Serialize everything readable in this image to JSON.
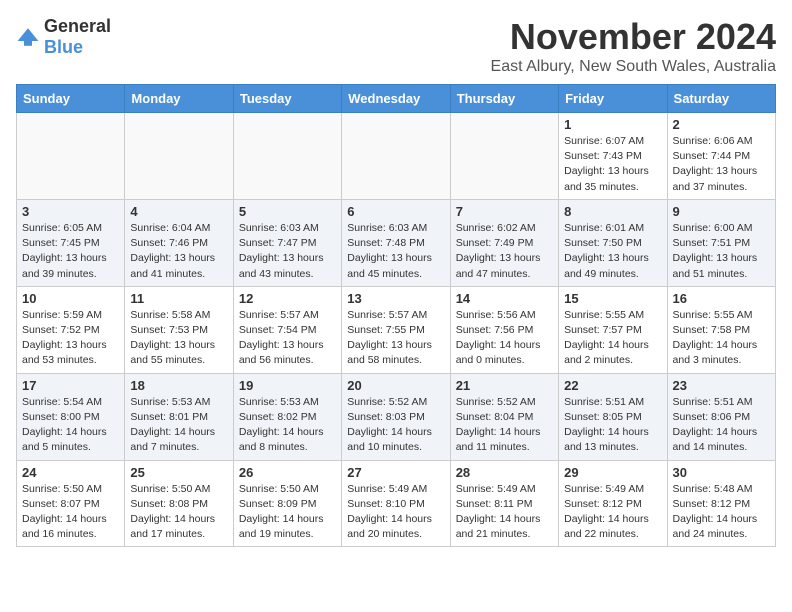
{
  "logo": {
    "general": "General",
    "blue": "Blue"
  },
  "title": "November 2024",
  "location": "East Albury, New South Wales, Australia",
  "headers": [
    "Sunday",
    "Monday",
    "Tuesday",
    "Wednesday",
    "Thursday",
    "Friday",
    "Saturday"
  ],
  "weeks": [
    [
      {
        "day": "",
        "info": ""
      },
      {
        "day": "",
        "info": ""
      },
      {
        "day": "",
        "info": ""
      },
      {
        "day": "",
        "info": ""
      },
      {
        "day": "",
        "info": ""
      },
      {
        "day": "1",
        "info": "Sunrise: 6:07 AM\nSunset: 7:43 PM\nDaylight: 13 hours\nand 35 minutes."
      },
      {
        "day": "2",
        "info": "Sunrise: 6:06 AM\nSunset: 7:44 PM\nDaylight: 13 hours\nand 37 minutes."
      }
    ],
    [
      {
        "day": "3",
        "info": "Sunrise: 6:05 AM\nSunset: 7:45 PM\nDaylight: 13 hours\nand 39 minutes."
      },
      {
        "day": "4",
        "info": "Sunrise: 6:04 AM\nSunset: 7:46 PM\nDaylight: 13 hours\nand 41 minutes."
      },
      {
        "day": "5",
        "info": "Sunrise: 6:03 AM\nSunset: 7:47 PM\nDaylight: 13 hours\nand 43 minutes."
      },
      {
        "day": "6",
        "info": "Sunrise: 6:03 AM\nSunset: 7:48 PM\nDaylight: 13 hours\nand 45 minutes."
      },
      {
        "day": "7",
        "info": "Sunrise: 6:02 AM\nSunset: 7:49 PM\nDaylight: 13 hours\nand 47 minutes."
      },
      {
        "day": "8",
        "info": "Sunrise: 6:01 AM\nSunset: 7:50 PM\nDaylight: 13 hours\nand 49 minutes."
      },
      {
        "day": "9",
        "info": "Sunrise: 6:00 AM\nSunset: 7:51 PM\nDaylight: 13 hours\nand 51 minutes."
      }
    ],
    [
      {
        "day": "10",
        "info": "Sunrise: 5:59 AM\nSunset: 7:52 PM\nDaylight: 13 hours\nand 53 minutes."
      },
      {
        "day": "11",
        "info": "Sunrise: 5:58 AM\nSunset: 7:53 PM\nDaylight: 13 hours\nand 55 minutes."
      },
      {
        "day": "12",
        "info": "Sunrise: 5:57 AM\nSunset: 7:54 PM\nDaylight: 13 hours\nand 56 minutes."
      },
      {
        "day": "13",
        "info": "Sunrise: 5:57 AM\nSunset: 7:55 PM\nDaylight: 13 hours\nand 58 minutes."
      },
      {
        "day": "14",
        "info": "Sunrise: 5:56 AM\nSunset: 7:56 PM\nDaylight: 14 hours\nand 0 minutes."
      },
      {
        "day": "15",
        "info": "Sunrise: 5:55 AM\nSunset: 7:57 PM\nDaylight: 14 hours\nand 2 minutes."
      },
      {
        "day": "16",
        "info": "Sunrise: 5:55 AM\nSunset: 7:58 PM\nDaylight: 14 hours\nand 3 minutes."
      }
    ],
    [
      {
        "day": "17",
        "info": "Sunrise: 5:54 AM\nSunset: 8:00 PM\nDaylight: 14 hours\nand 5 minutes."
      },
      {
        "day": "18",
        "info": "Sunrise: 5:53 AM\nSunset: 8:01 PM\nDaylight: 14 hours\nand 7 minutes."
      },
      {
        "day": "19",
        "info": "Sunrise: 5:53 AM\nSunset: 8:02 PM\nDaylight: 14 hours\nand 8 minutes."
      },
      {
        "day": "20",
        "info": "Sunrise: 5:52 AM\nSunset: 8:03 PM\nDaylight: 14 hours\nand 10 minutes."
      },
      {
        "day": "21",
        "info": "Sunrise: 5:52 AM\nSunset: 8:04 PM\nDaylight: 14 hours\nand 11 minutes."
      },
      {
        "day": "22",
        "info": "Sunrise: 5:51 AM\nSunset: 8:05 PM\nDaylight: 14 hours\nand 13 minutes."
      },
      {
        "day": "23",
        "info": "Sunrise: 5:51 AM\nSunset: 8:06 PM\nDaylight: 14 hours\nand 14 minutes."
      }
    ],
    [
      {
        "day": "24",
        "info": "Sunrise: 5:50 AM\nSunset: 8:07 PM\nDaylight: 14 hours\nand 16 minutes."
      },
      {
        "day": "25",
        "info": "Sunrise: 5:50 AM\nSunset: 8:08 PM\nDaylight: 14 hours\nand 17 minutes."
      },
      {
        "day": "26",
        "info": "Sunrise: 5:50 AM\nSunset: 8:09 PM\nDaylight: 14 hours\nand 19 minutes."
      },
      {
        "day": "27",
        "info": "Sunrise: 5:49 AM\nSunset: 8:10 PM\nDaylight: 14 hours\nand 20 minutes."
      },
      {
        "day": "28",
        "info": "Sunrise: 5:49 AM\nSunset: 8:11 PM\nDaylight: 14 hours\nand 21 minutes."
      },
      {
        "day": "29",
        "info": "Sunrise: 5:49 AM\nSunset: 8:12 PM\nDaylight: 14 hours\nand 22 minutes."
      },
      {
        "day": "30",
        "info": "Sunrise: 5:48 AM\nSunset: 8:12 PM\nDaylight: 14 hours\nand 24 minutes."
      }
    ]
  ]
}
